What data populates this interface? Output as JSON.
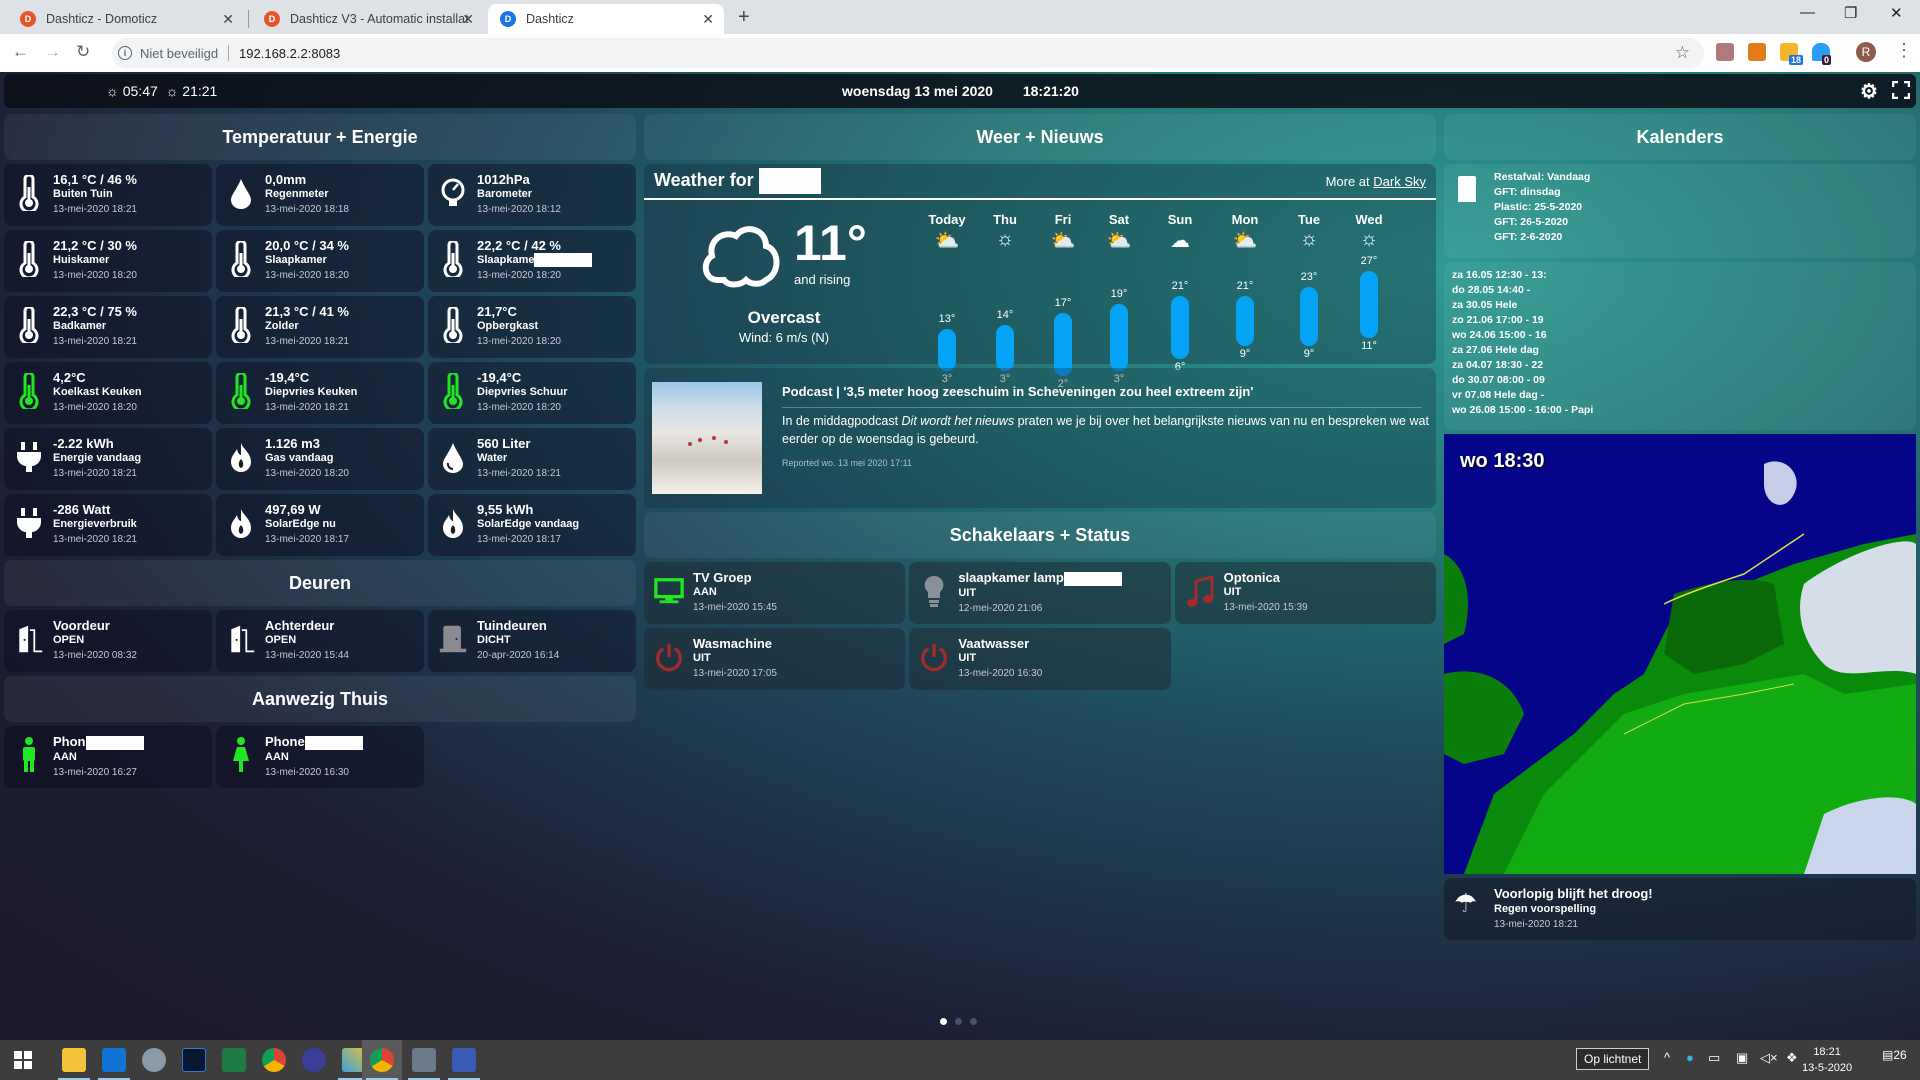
{
  "browser": {
    "tabs": [
      {
        "title": "Dashticz - Domoticz",
        "active": false
      },
      {
        "title": "Dashticz V3 - Automatic installat",
        "active": false
      },
      {
        "title": "Dashticz",
        "active": true
      }
    ],
    "security_label": "Niet beveiligd",
    "url": "192.168.2.2:8083",
    "extension_badges": {
      "rss": "18",
      "ghost": "0"
    },
    "profile_initial": "R"
  },
  "topbar": {
    "sunrise": "05:47",
    "sunset": "21:21",
    "date": "woensdag 13 mei 2020",
    "time": "18:21:20"
  },
  "temperature": {
    "title": "Temperatuur + Energie",
    "tiles": [
      {
        "icon": "thermometer-icon",
        "value": "16,1 °C / 46 %",
        "name": "Buiten Tuin",
        "ts": "13-mei-2020 18:21",
        "color": "#ffffff"
      },
      {
        "icon": "raindrop-icon",
        "value": "0,0mm",
        "name": "Regenmeter",
        "ts": "13-mei-2020 18:18",
        "color": "#ffffff"
      },
      {
        "icon": "barometer-icon",
        "value": "1012hPa",
        "name": "Barometer",
        "ts": "13-mei-2020 18:12",
        "color": "#ffffff"
      },
      {
        "icon": "thermometer-icon",
        "value": "21,2 °C / 30 %",
        "name": "Huiskamer",
        "ts": "13-mei-2020 18:20",
        "color": "#ffffff"
      },
      {
        "icon": "thermometer-icon",
        "value": "20,0 °C / 34 %",
        "name": "Slaapkamer",
        "ts": "13-mei-2020 18:20",
        "color": "#ffffff"
      },
      {
        "icon": "thermometer-icon",
        "value": "22,2 °C / 42 %",
        "name": "Slaapkame",
        "ts": "13-mei-2020 18:20",
        "color": "#ffffff",
        "masked": true
      },
      {
        "icon": "thermometer-icon",
        "value": "22,3 °C / 75 %",
        "name": "Badkamer",
        "ts": "13-mei-2020 18:21",
        "color": "#ffffff"
      },
      {
        "icon": "thermometer-icon",
        "value": "21,3 °C / 41 %",
        "name": "Zolder",
        "ts": "13-mei-2020 18:21",
        "color": "#ffffff"
      },
      {
        "icon": "thermometer-icon",
        "value": "21,7°C",
        "name": "Opbergkast",
        "ts": "13-mei-2020 18:20",
        "color": "#ffffff"
      },
      {
        "icon": "thermometer-icon",
        "value": "4,2°C",
        "name": "Koelkast Keuken",
        "ts": "13-mei-2020 18:20",
        "color": "#22e622"
      },
      {
        "icon": "thermometer-icon",
        "value": "-19,4°C",
        "name": "Diepvries Keuken",
        "ts": "13-mei-2020 18:21",
        "color": "#22e622"
      },
      {
        "icon": "thermometer-icon",
        "value": "-19,4°C",
        "name": "Diepvries Schuur",
        "ts": "13-mei-2020 18:20",
        "color": "#22e622"
      },
      {
        "icon": "plug-icon",
        "value": "-2.22 kWh",
        "name": "Energie vandaag",
        "ts": "13-mei-2020 18:21",
        "color": "#ffffff"
      },
      {
        "icon": "flame-icon",
        "value": "1.126 m3",
        "name": "Gas vandaag",
        "ts": "13-mei-2020 18:20",
        "color": "#ffffff"
      },
      {
        "icon": "water-drop-icon",
        "value": "560 Liter",
        "name": "Water",
        "ts": "13-mei-2020 18:21",
        "color": "#ffffff"
      },
      {
        "icon": "plug-icon",
        "value": "-286 Watt",
        "name": "Energieverbruik",
        "ts": "13-mei-2020 18:21",
        "color": "#ffffff"
      },
      {
        "icon": "flame-icon",
        "value": "497,69 W",
        "name": "SolarEdge nu",
        "ts": "13-mei-2020 18:17",
        "color": "#ffffff"
      },
      {
        "icon": "flame-icon",
        "value": "9,55 kWh",
        "name": "SolarEdge vandaag",
        "ts": "13-mei-2020 18:17",
        "color": "#ffffff"
      }
    ]
  },
  "doors": {
    "title": "Deuren",
    "tiles": [
      {
        "icon": "door-open-icon",
        "value": "Voordeur",
        "name": "OPEN",
        "ts": "13-mei-2020 08:32",
        "color": "#ffffff"
      },
      {
        "icon": "door-open-icon",
        "value": "Achterdeur",
        "name": "OPEN",
        "ts": "13-mei-2020 15:44",
        "color": "#ffffff"
      },
      {
        "icon": "door-closed-icon",
        "value": "Tuindeuren",
        "name": "DICHT",
        "ts": "20-apr-2020 16:14",
        "color": "#8a8a90"
      }
    ]
  },
  "presence": {
    "title": "Aanwezig Thuis",
    "tiles": [
      {
        "icon": "person-male-icon",
        "value": "Phon",
        "name": "AAN",
        "ts": "13-mei-2020 16:27",
        "color": "#22e622",
        "masked": true
      },
      {
        "icon": "person-female-icon",
        "value": "Phone",
        "name": "AAN",
        "ts": "13-mei-2020 16:30",
        "color": "#22e622",
        "masked": true
      }
    ]
  },
  "weather": {
    "section_title": "Weer + Nieuws",
    "header": "Weather for",
    "more_prefix": "More at",
    "more_link": "Dark Sky",
    "current_temp": "11°",
    "trend": "and rising",
    "condition": "Overcast",
    "wind": "Wind: 6 m/s (N)",
    "forecast": [
      {
        "day": "Today",
        "icon": "partly-cloudy-icon",
        "hi": 13,
        "lo": 3
      },
      {
        "day": "Thu",
        "icon": "sun-icon",
        "hi": 14,
        "lo": 3
      },
      {
        "day": "Fri",
        "icon": "partly-cloudy-icon",
        "hi": 17,
        "lo": 2
      },
      {
        "day": "Sat",
        "icon": "partly-cloudy-icon",
        "hi": 19,
        "lo": 3
      },
      {
        "day": "Sun",
        "icon": "cloud-icon",
        "hi": 21,
        "lo": 6
      },
      {
        "day": "Mon",
        "icon": "partly-cloudy-icon",
        "hi": 21,
        "lo": 9
      },
      {
        "day": "Tue",
        "icon": "sun-icon",
        "hi": 23,
        "lo": 9
      },
      {
        "day": "Wed",
        "icon": "sun-icon",
        "hi": 27,
        "lo": 11
      }
    ]
  },
  "news": {
    "title": "Podcast | '3,5 meter hoog zeeschuim in Scheveningen zou heel extreem zijn'",
    "body_pre": "In de middagpodcast ",
    "body_em": "Dit wordt het nieuws",
    "body_post": " praten we je bij over het belangrijkste nieuws van nu en bespreken we wat eerder op de woensdag is gebeurd.",
    "reported": "Reported wo. 13 mei 2020 17:11"
  },
  "switches": {
    "title": "Schakelaars + Status",
    "tiles": [
      {
        "icon": "tv-icon",
        "value": "TV Groep",
        "name": "AAN",
        "ts": "13-mei-2020 15:45",
        "color": "#22e622"
      },
      {
        "icon": "lightbulb-icon",
        "value": "slaapkamer lamp",
        "name": "UIT",
        "ts": "12-mei-2020 21:06",
        "color": "#8a9098",
        "masked": true
      },
      {
        "icon": "music-note-icon",
        "value": "Optonica",
        "name": "UIT",
        "ts": "13-mei-2020 15:39",
        "color": "#a52a2a"
      },
      {
        "icon": "power-icon",
        "value": "Wasmachine",
        "name": "UIT",
        "ts": "13-mei-2020 17:05",
        "color": "#a52a2a"
      },
      {
        "icon": "power-icon",
        "value": "Vaatwasser",
        "name": "UIT",
        "ts": "13-mei-2020 16:30",
        "color": "#a52a2a"
      }
    ]
  },
  "calendars": {
    "title": "Kalenders",
    "waste": [
      "Restafval: Vandaag",
      "GFT: dinsdag",
      "Plastic: 25-5-2020",
      "GFT: 26-5-2020",
      "GFT: 2-6-2020"
    ],
    "events": [
      "za 16.05 12:30 - 13:",
      "do 28.05 14:40 -",
      "za 30.05 Hele",
      "zo 21.06 17:00 - 19",
      "wo 24.06 15:00 - 16",
      "za 27.06 Hele dag",
      "za 04.07 18:30 - 22",
      "do 30.07 08:00 - 09",
      "vr 07.08 Hele dag -",
      "wo 26.08 15:00 - 16:00 - Papi"
    ]
  },
  "radar": {
    "time": "wo 18:30"
  },
  "rain": {
    "value": "Voorlopig blijft het droog!",
    "name": "Regen voorspelling",
    "ts": "13-mei-2020 18:21"
  },
  "taskbar": {
    "tooltip": "Op lichtnet",
    "clock_time": "18:21",
    "clock_date": "13-5-2020",
    "notifications": "26"
  }
}
